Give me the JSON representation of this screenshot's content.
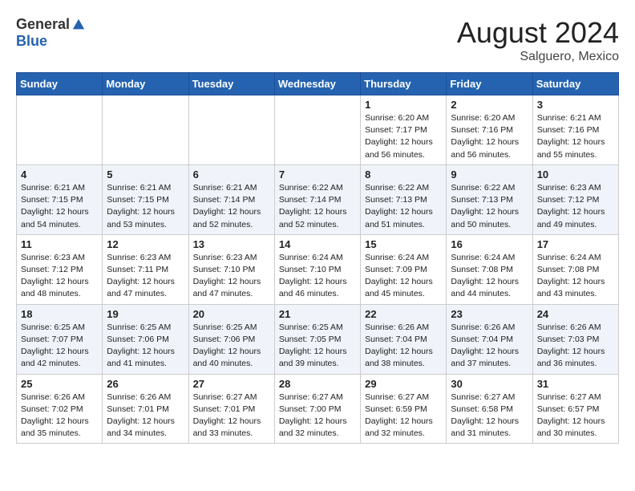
{
  "header": {
    "logo_general": "General",
    "logo_blue": "Blue",
    "main_title": "August 2024",
    "subtitle": "Salguero, Mexico"
  },
  "days_of_week": [
    "Sunday",
    "Monday",
    "Tuesday",
    "Wednesday",
    "Thursday",
    "Friday",
    "Saturday"
  ],
  "weeks": [
    {
      "days": [
        {
          "num": "",
          "empty": true
        },
        {
          "num": "",
          "empty": true
        },
        {
          "num": "",
          "empty": true
        },
        {
          "num": "",
          "empty": true
        },
        {
          "num": "1",
          "rise": "6:20 AM",
          "set": "7:17 PM",
          "daylight": "12 hours and 56 minutes."
        },
        {
          "num": "2",
          "rise": "6:20 AM",
          "set": "7:16 PM",
          "daylight": "12 hours and 56 minutes."
        },
        {
          "num": "3",
          "rise": "6:21 AM",
          "set": "7:16 PM",
          "daylight": "12 hours and 55 minutes."
        }
      ]
    },
    {
      "days": [
        {
          "num": "4",
          "rise": "6:21 AM",
          "set": "7:15 PM",
          "daylight": "12 hours and 54 minutes."
        },
        {
          "num": "5",
          "rise": "6:21 AM",
          "set": "7:15 PM",
          "daylight": "12 hours and 53 minutes."
        },
        {
          "num": "6",
          "rise": "6:21 AM",
          "set": "7:14 PM",
          "daylight": "12 hours and 52 minutes."
        },
        {
          "num": "7",
          "rise": "6:22 AM",
          "set": "7:14 PM",
          "daylight": "12 hours and 52 minutes."
        },
        {
          "num": "8",
          "rise": "6:22 AM",
          "set": "7:13 PM",
          "daylight": "12 hours and 51 minutes."
        },
        {
          "num": "9",
          "rise": "6:22 AM",
          "set": "7:13 PM",
          "daylight": "12 hours and 50 minutes."
        },
        {
          "num": "10",
          "rise": "6:23 AM",
          "set": "7:12 PM",
          "daylight": "12 hours and 49 minutes."
        }
      ]
    },
    {
      "days": [
        {
          "num": "11",
          "rise": "6:23 AM",
          "set": "7:12 PM",
          "daylight": "12 hours and 48 minutes."
        },
        {
          "num": "12",
          "rise": "6:23 AM",
          "set": "7:11 PM",
          "daylight": "12 hours and 47 minutes."
        },
        {
          "num": "13",
          "rise": "6:23 AM",
          "set": "7:10 PM",
          "daylight": "12 hours and 47 minutes."
        },
        {
          "num": "14",
          "rise": "6:24 AM",
          "set": "7:10 PM",
          "daylight": "12 hours and 46 minutes."
        },
        {
          "num": "15",
          "rise": "6:24 AM",
          "set": "7:09 PM",
          "daylight": "12 hours and 45 minutes."
        },
        {
          "num": "16",
          "rise": "6:24 AM",
          "set": "7:08 PM",
          "daylight": "12 hours and 44 minutes."
        },
        {
          "num": "17",
          "rise": "6:24 AM",
          "set": "7:08 PM",
          "daylight": "12 hours and 43 minutes."
        }
      ]
    },
    {
      "days": [
        {
          "num": "18",
          "rise": "6:25 AM",
          "set": "7:07 PM",
          "daylight": "12 hours and 42 minutes."
        },
        {
          "num": "19",
          "rise": "6:25 AM",
          "set": "7:06 PM",
          "daylight": "12 hours and 41 minutes."
        },
        {
          "num": "20",
          "rise": "6:25 AM",
          "set": "7:06 PM",
          "daylight": "12 hours and 40 minutes."
        },
        {
          "num": "21",
          "rise": "6:25 AM",
          "set": "7:05 PM",
          "daylight": "12 hours and 39 minutes."
        },
        {
          "num": "22",
          "rise": "6:26 AM",
          "set": "7:04 PM",
          "daylight": "12 hours and 38 minutes."
        },
        {
          "num": "23",
          "rise": "6:26 AM",
          "set": "7:04 PM",
          "daylight": "12 hours and 37 minutes."
        },
        {
          "num": "24",
          "rise": "6:26 AM",
          "set": "7:03 PM",
          "daylight": "12 hours and 36 minutes."
        }
      ]
    },
    {
      "days": [
        {
          "num": "25",
          "rise": "6:26 AM",
          "set": "7:02 PM",
          "daylight": "12 hours and 35 minutes."
        },
        {
          "num": "26",
          "rise": "6:26 AM",
          "set": "7:01 PM",
          "daylight": "12 hours and 34 minutes."
        },
        {
          "num": "27",
          "rise": "6:27 AM",
          "set": "7:01 PM",
          "daylight": "12 hours and 33 minutes."
        },
        {
          "num": "28",
          "rise": "6:27 AM",
          "set": "7:00 PM",
          "daylight": "12 hours and 32 minutes."
        },
        {
          "num": "29",
          "rise": "6:27 AM",
          "set": "6:59 PM",
          "daylight": "12 hours and 32 minutes."
        },
        {
          "num": "30",
          "rise": "6:27 AM",
          "set": "6:58 PM",
          "daylight": "12 hours and 31 minutes."
        },
        {
          "num": "31",
          "rise": "6:27 AM",
          "set": "6:57 PM",
          "daylight": "12 hours and 30 minutes."
        }
      ]
    }
  ]
}
